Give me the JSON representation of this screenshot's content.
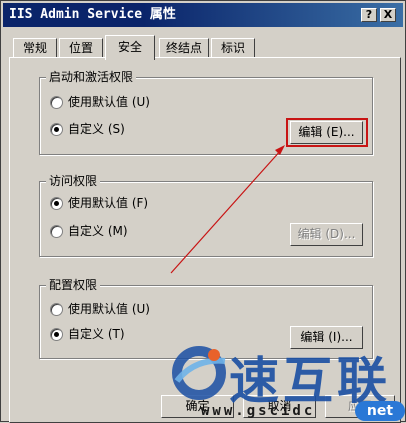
{
  "window": {
    "title": "IIS Admin Service 属性",
    "help_label": "?",
    "close_label": "X"
  },
  "tabs": [
    {
      "label": "常规",
      "active": false
    },
    {
      "label": "位置",
      "active": false
    },
    {
      "label": "安全",
      "active": true
    },
    {
      "label": "终结点",
      "active": false
    },
    {
      "label": "标识",
      "active": false
    }
  ],
  "launch_group": {
    "title": "启动和激活权限",
    "option_default": "使用默认值 (U)",
    "option_custom": "自定义 (S)",
    "selected": "custom",
    "edit_label": "编辑 (E)..."
  },
  "access_group": {
    "title": "访问权限",
    "option_default": "使用默认值 (F)",
    "option_custom": "自定义 (M)",
    "selected": "default",
    "edit_label": "编辑 (D)..."
  },
  "config_group": {
    "title": "配置权限",
    "option_default": "使用默认值 (U)",
    "option_custom": "自定义 (T)",
    "selected": "custom",
    "edit_label": "编辑 (I)..."
  },
  "footer": {
    "ok_label": "确定",
    "cancel_label": "取消",
    "apply_label": "应用"
  },
  "watermark": {
    "brand": "速互联",
    "url": "www.gscidc",
    "badge": "net"
  },
  "colors": {
    "titlebar": "#0a246a",
    "highlight": "#c81414",
    "watermark": "#1a4fa3"
  }
}
